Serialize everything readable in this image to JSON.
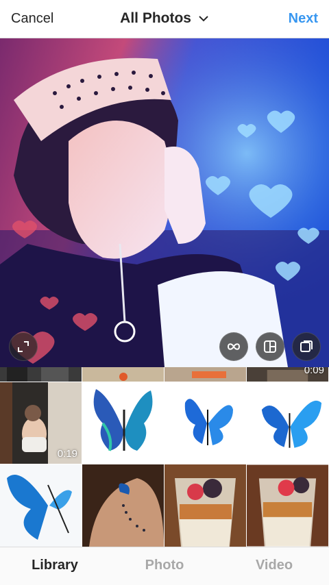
{
  "header": {
    "cancel_label": "Cancel",
    "title": "All Photos",
    "next_label": "Next"
  },
  "preview": {
    "controls": [
      "expand-icon",
      "boomerang-icon",
      "layout-icon",
      "multi-select-icon"
    ]
  },
  "grid": {
    "video_durations": [
      "0:09",
      "0:19"
    ]
  },
  "tabs": {
    "items": [
      {
        "label": "Library",
        "active": true
      },
      {
        "label": "Photo",
        "active": false
      },
      {
        "label": "Video",
        "active": false
      }
    ]
  },
  "colors": {
    "accent": "#3897f0",
    "text": "#262626",
    "inactive_tab": "#a8a8a8"
  }
}
